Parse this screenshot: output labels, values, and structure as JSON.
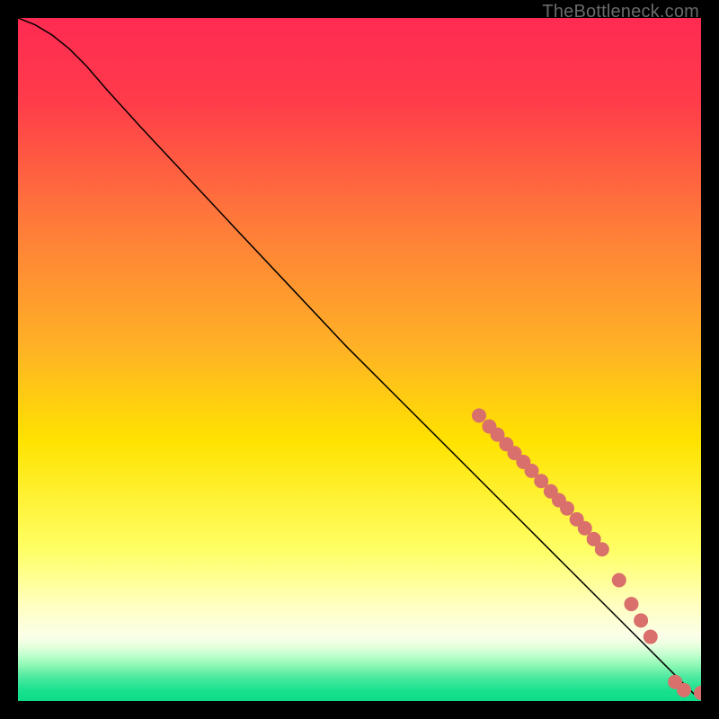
{
  "watermark": "TheBottleneck.com",
  "chart_data": {
    "type": "line",
    "title": "",
    "xlabel": "",
    "ylabel": "",
    "xlim": [
      0,
      1
    ],
    "ylim": [
      0,
      1
    ],
    "grid": false,
    "legend": false,
    "background_gradient_stops": [
      {
        "offset": 0.0,
        "color": "#ff2b52"
      },
      {
        "offset": 0.12,
        "color": "#ff3b4a"
      },
      {
        "offset": 0.3,
        "color": "#ff7a3a"
      },
      {
        "offset": 0.48,
        "color": "#ffb126"
      },
      {
        "offset": 0.62,
        "color": "#ffe300"
      },
      {
        "offset": 0.78,
        "color": "#ffff66"
      },
      {
        "offset": 0.86,
        "color": "#ffffc0"
      },
      {
        "offset": 0.905,
        "color": "#fbffe8"
      },
      {
        "offset": 0.918,
        "color": "#e9ffdf"
      },
      {
        "offset": 0.932,
        "color": "#c3ffcf"
      },
      {
        "offset": 0.948,
        "color": "#8cf7b3"
      },
      {
        "offset": 0.965,
        "color": "#4de9a0"
      },
      {
        "offset": 0.985,
        "color": "#17e18e"
      },
      {
        "offset": 1.0,
        "color": "#0fdc88"
      }
    ],
    "series": [
      {
        "name": "curve",
        "color": "#000000",
        "stroke_width": 1.5,
        "x": [
          0.0,
          0.025,
          0.05,
          0.075,
          0.1,
          0.13,
          0.18,
          0.25,
          0.32,
          0.4,
          0.48,
          0.56,
          0.64,
          0.7,
          0.74,
          0.78,
          0.82,
          0.86,
          0.9,
          0.93,
          0.955,
          0.97,
          0.98,
          0.99,
          1.0
        ],
        "y": [
          1.0,
          0.99,
          0.975,
          0.955,
          0.93,
          0.895,
          0.84,
          0.765,
          0.69,
          0.605,
          0.52,
          0.44,
          0.36,
          0.3,
          0.26,
          0.22,
          0.18,
          0.14,
          0.1,
          0.07,
          0.045,
          0.03,
          0.02,
          0.01,
          0.01
        ]
      }
    ],
    "markers": {
      "name": "highlight-dots",
      "color": "#d9706c",
      "radius": 8,
      "points": [
        {
          "x": 0.675,
          "y": 0.418
        },
        {
          "x": 0.69,
          "y": 0.402
        },
        {
          "x": 0.702,
          "y": 0.39
        },
        {
          "x": 0.715,
          "y": 0.376
        },
        {
          "x": 0.727,
          "y": 0.363
        },
        {
          "x": 0.74,
          "y": 0.35
        },
        {
          "x": 0.752,
          "y": 0.337
        },
        {
          "x": 0.766,
          "y": 0.322
        },
        {
          "x": 0.78,
          "y": 0.307
        },
        {
          "x": 0.792,
          "y": 0.294
        },
        {
          "x": 0.804,
          "y": 0.282
        },
        {
          "x": 0.818,
          "y": 0.266
        },
        {
          "x": 0.83,
          "y": 0.253
        },
        {
          "x": 0.843,
          "y": 0.237
        },
        {
          "x": 0.855,
          "y": 0.222
        },
        {
          "x": 0.88,
          "y": 0.177
        },
        {
          "x": 0.898,
          "y": 0.142
        },
        {
          "x": 0.912,
          "y": 0.118
        },
        {
          "x": 0.926,
          "y": 0.094
        },
        {
          "x": 0.962,
          "y": 0.028
        },
        {
          "x": 0.975,
          "y": 0.016
        },
        {
          "x": 1.0,
          "y": 0.012
        }
      ]
    }
  }
}
